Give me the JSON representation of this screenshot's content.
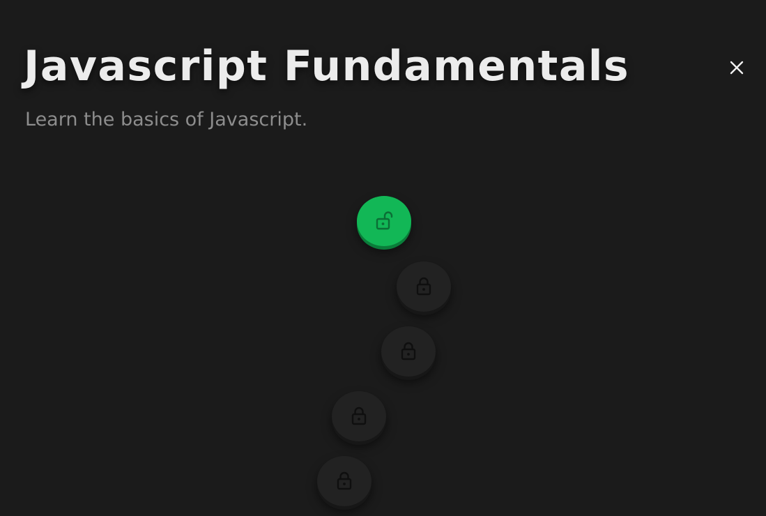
{
  "course": {
    "title": "Javascript Fundamentals",
    "subtitle": "Learn the basics of Javascript."
  },
  "colors": {
    "background": "#1b1b1b",
    "unlocked": "#12b756",
    "locked": "#222222",
    "icon_on_unlocked": "#0b6e35",
    "icon_on_locked": "#0f0f0f"
  },
  "icons": {
    "close": "close-icon",
    "unlocked": "lock-open-icon",
    "locked": "lock-icon"
  },
  "lessons": [
    {
      "state": "unlocked",
      "icon": "lock-open-icon"
    },
    {
      "state": "locked",
      "icon": "lock-icon"
    },
    {
      "state": "locked",
      "icon": "lock-icon"
    },
    {
      "state": "locked",
      "icon": "lock-icon"
    },
    {
      "state": "locked",
      "icon": "lock-icon"
    }
  ]
}
